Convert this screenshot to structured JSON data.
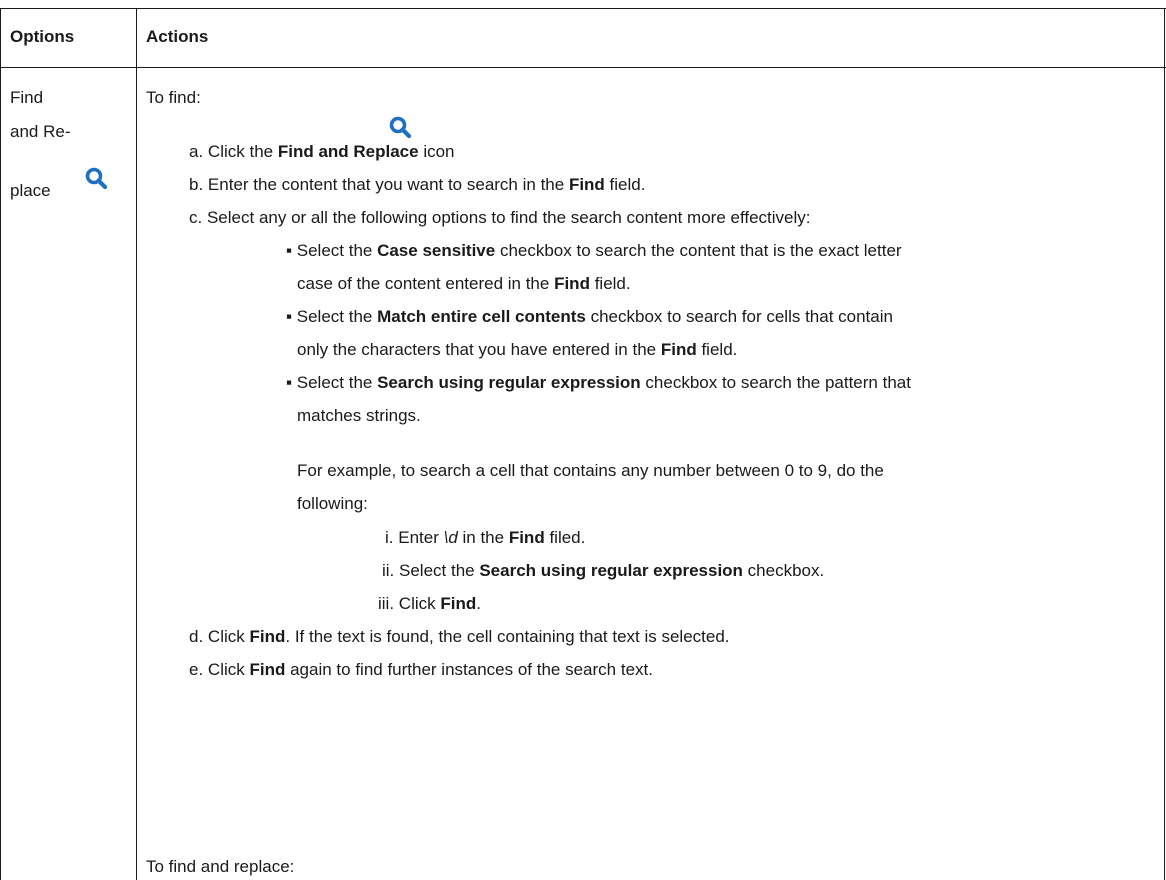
{
  "table": {
    "headers": {
      "options": "Options",
      "actions": "Actions"
    },
    "option_label": {
      "line1": "Find",
      "line2": "and Re-",
      "line3": "place"
    },
    "icon": "search-icon",
    "icon_color": "#1f70c1"
  },
  "content": {
    "to_find": "To find:",
    "step_a": {
      "marker": "a.",
      "pre": "Click the ",
      "bold": "Find and Replace",
      "post": " icon",
      "tail": "."
    },
    "step_b": {
      "marker": "b.",
      "pre": "Enter the content that you want to search in the ",
      "bold": "Find",
      "post": " field."
    },
    "step_c": {
      "marker": "c.",
      "text": "Select any or all the following options to find the search content more effectively:"
    },
    "bullet1": {
      "pre": "Select the ",
      "bold": "Case sensitive",
      "post": " checkbox to search the content that is the exact letter",
      "line2_pre": "case of the content entered in the ",
      "line2_bold": "Find",
      "line2_post": " field."
    },
    "bullet2": {
      "pre": "Select the ",
      "bold": "Match entire cell contents",
      "post": " checkbox to search for cells that contain",
      "line2_pre": "only the characters that you have entered in the ",
      "line2_bold": "Find",
      "line2_post": " field."
    },
    "bullet3": {
      "pre": "Select the ",
      "bold": "Search using regular expression",
      "post": " checkbox to search the pattern that",
      "line2": "matches strings."
    },
    "example": {
      "line1": "For example, to search a cell that contains any number between 0 to 9, do the",
      "line2": "following:"
    },
    "sub_i": {
      "marker": "i.",
      "pre": "Enter ",
      "italic": "\\d",
      "mid": " in the ",
      "bold": "Find",
      "post": " filed."
    },
    "sub_ii": {
      "marker": "ii.",
      "pre": "Select the ",
      "bold": "Search using regular expression",
      "post": " checkbox."
    },
    "sub_iii": {
      "marker": "iii.",
      "pre": "Click ",
      "bold": "Find",
      "post": "."
    },
    "step_d": {
      "marker": "d.",
      "pre": "Click ",
      "bold": "Find",
      "post": ". If the text is found, the cell containing that text is selected."
    },
    "step_e": {
      "marker": "e.",
      "pre": "Click ",
      "bold": "Find",
      "post": " again to find further instances of the search text."
    },
    "to_find_replace": "To find and replace:"
  }
}
